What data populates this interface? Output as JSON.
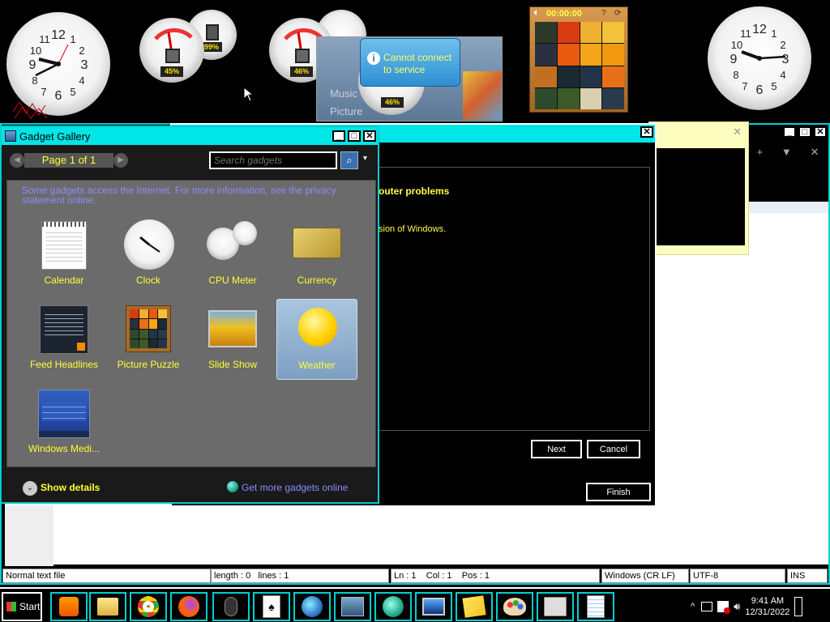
{
  "desktop": {
    "cpu_gauges": [
      {
        "cpu": "45%",
        "mem": "99%"
      },
      {
        "cpu": "46%"
      },
      {
        "cpu": "46%"
      }
    ],
    "puzzle_timer": "00:00:00",
    "weather_balloon": "Cannot connect to service",
    "slideshow_text": [
      "Music",
      "Picture"
    ]
  },
  "gadget_gallery": {
    "title": "Gadget Gallery",
    "page_label": "Page 1 of 1",
    "search_placeholder": "Search gadgets",
    "privacy_text": "Some gadgets access the Internet.  For more information, see the privacy statement online.",
    "gadgets": [
      {
        "label": "Calendar"
      },
      {
        "label": "Clock"
      },
      {
        "label": "CPU Meter"
      },
      {
        "label": "Currency"
      },
      {
        "label": "Feed Headlines"
      },
      {
        "label": "Picture Puzzle"
      },
      {
        "label": "Slide Show"
      },
      {
        "label": "Weather"
      },
      {
        "label": "Windows Medi..."
      }
    ],
    "show_details": "Show details",
    "get_more": "Get more gadgets online"
  },
  "wizard": {
    "heading_fragment": "outer problems",
    "body_fragment": "sion of Windows.",
    "next_label": "Next",
    "cancel_label": "Cancel",
    "finish_label": "Finish"
  },
  "notepad": {
    "status": {
      "file_type": "Normal text file",
      "length": "length : 0",
      "lines": "lines : 1",
      "position": "Ln : 1    Col : 1    Pos : 1",
      "eol": "Windows (CR LF)",
      "encoding": "UTF-8",
      "mode": "INS"
    }
  },
  "taskbar": {
    "start_label": "Start",
    "time": "9:41 AM",
    "date": "12/31/2022"
  },
  "colors": {
    "title_accent": "#00e5e5",
    "gadget_label": "#ffff33",
    "privacy_text": "#8c8cff"
  }
}
